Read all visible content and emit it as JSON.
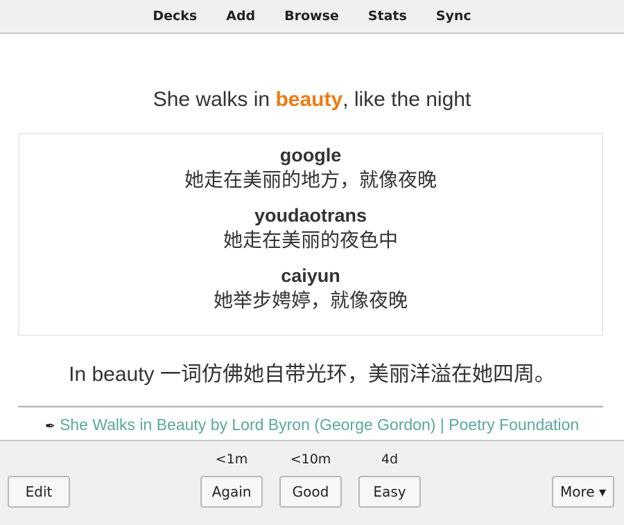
{
  "toolbar": {
    "items": [
      "Decks",
      "Add",
      "Browse",
      "Stats",
      "Sync"
    ]
  },
  "card": {
    "front_before": "She walks in ",
    "front_highlight": "beauty",
    "front_after": ", like the night",
    "highlight_color": "#f07a12",
    "translations": [
      {
        "engine": "google",
        "text": "她走在美丽的地方，就像夜晚"
      },
      {
        "engine": "youdaotrans",
        "text": "她走在美丽的夜色中"
      },
      {
        "engine": "caiyun",
        "text": "她举步娉婷，就像夜晚"
      }
    ],
    "note": "In beauty 一词仿佛她自带光环，美丽洋溢在她四周。",
    "source_icon": "quill-icon",
    "source_link": "She Walks in Beauty by Lord Byron (George Gordon) | Poetry Foundation",
    "link_color": "#5aa99a"
  },
  "answer_bar": {
    "edit_label": "Edit",
    "more_label": "More ▾",
    "buttons": [
      {
        "label": "Again",
        "due": "<1m"
      },
      {
        "label": "Good",
        "due": "<10m"
      },
      {
        "label": "Easy",
        "due": "4d"
      }
    ]
  }
}
